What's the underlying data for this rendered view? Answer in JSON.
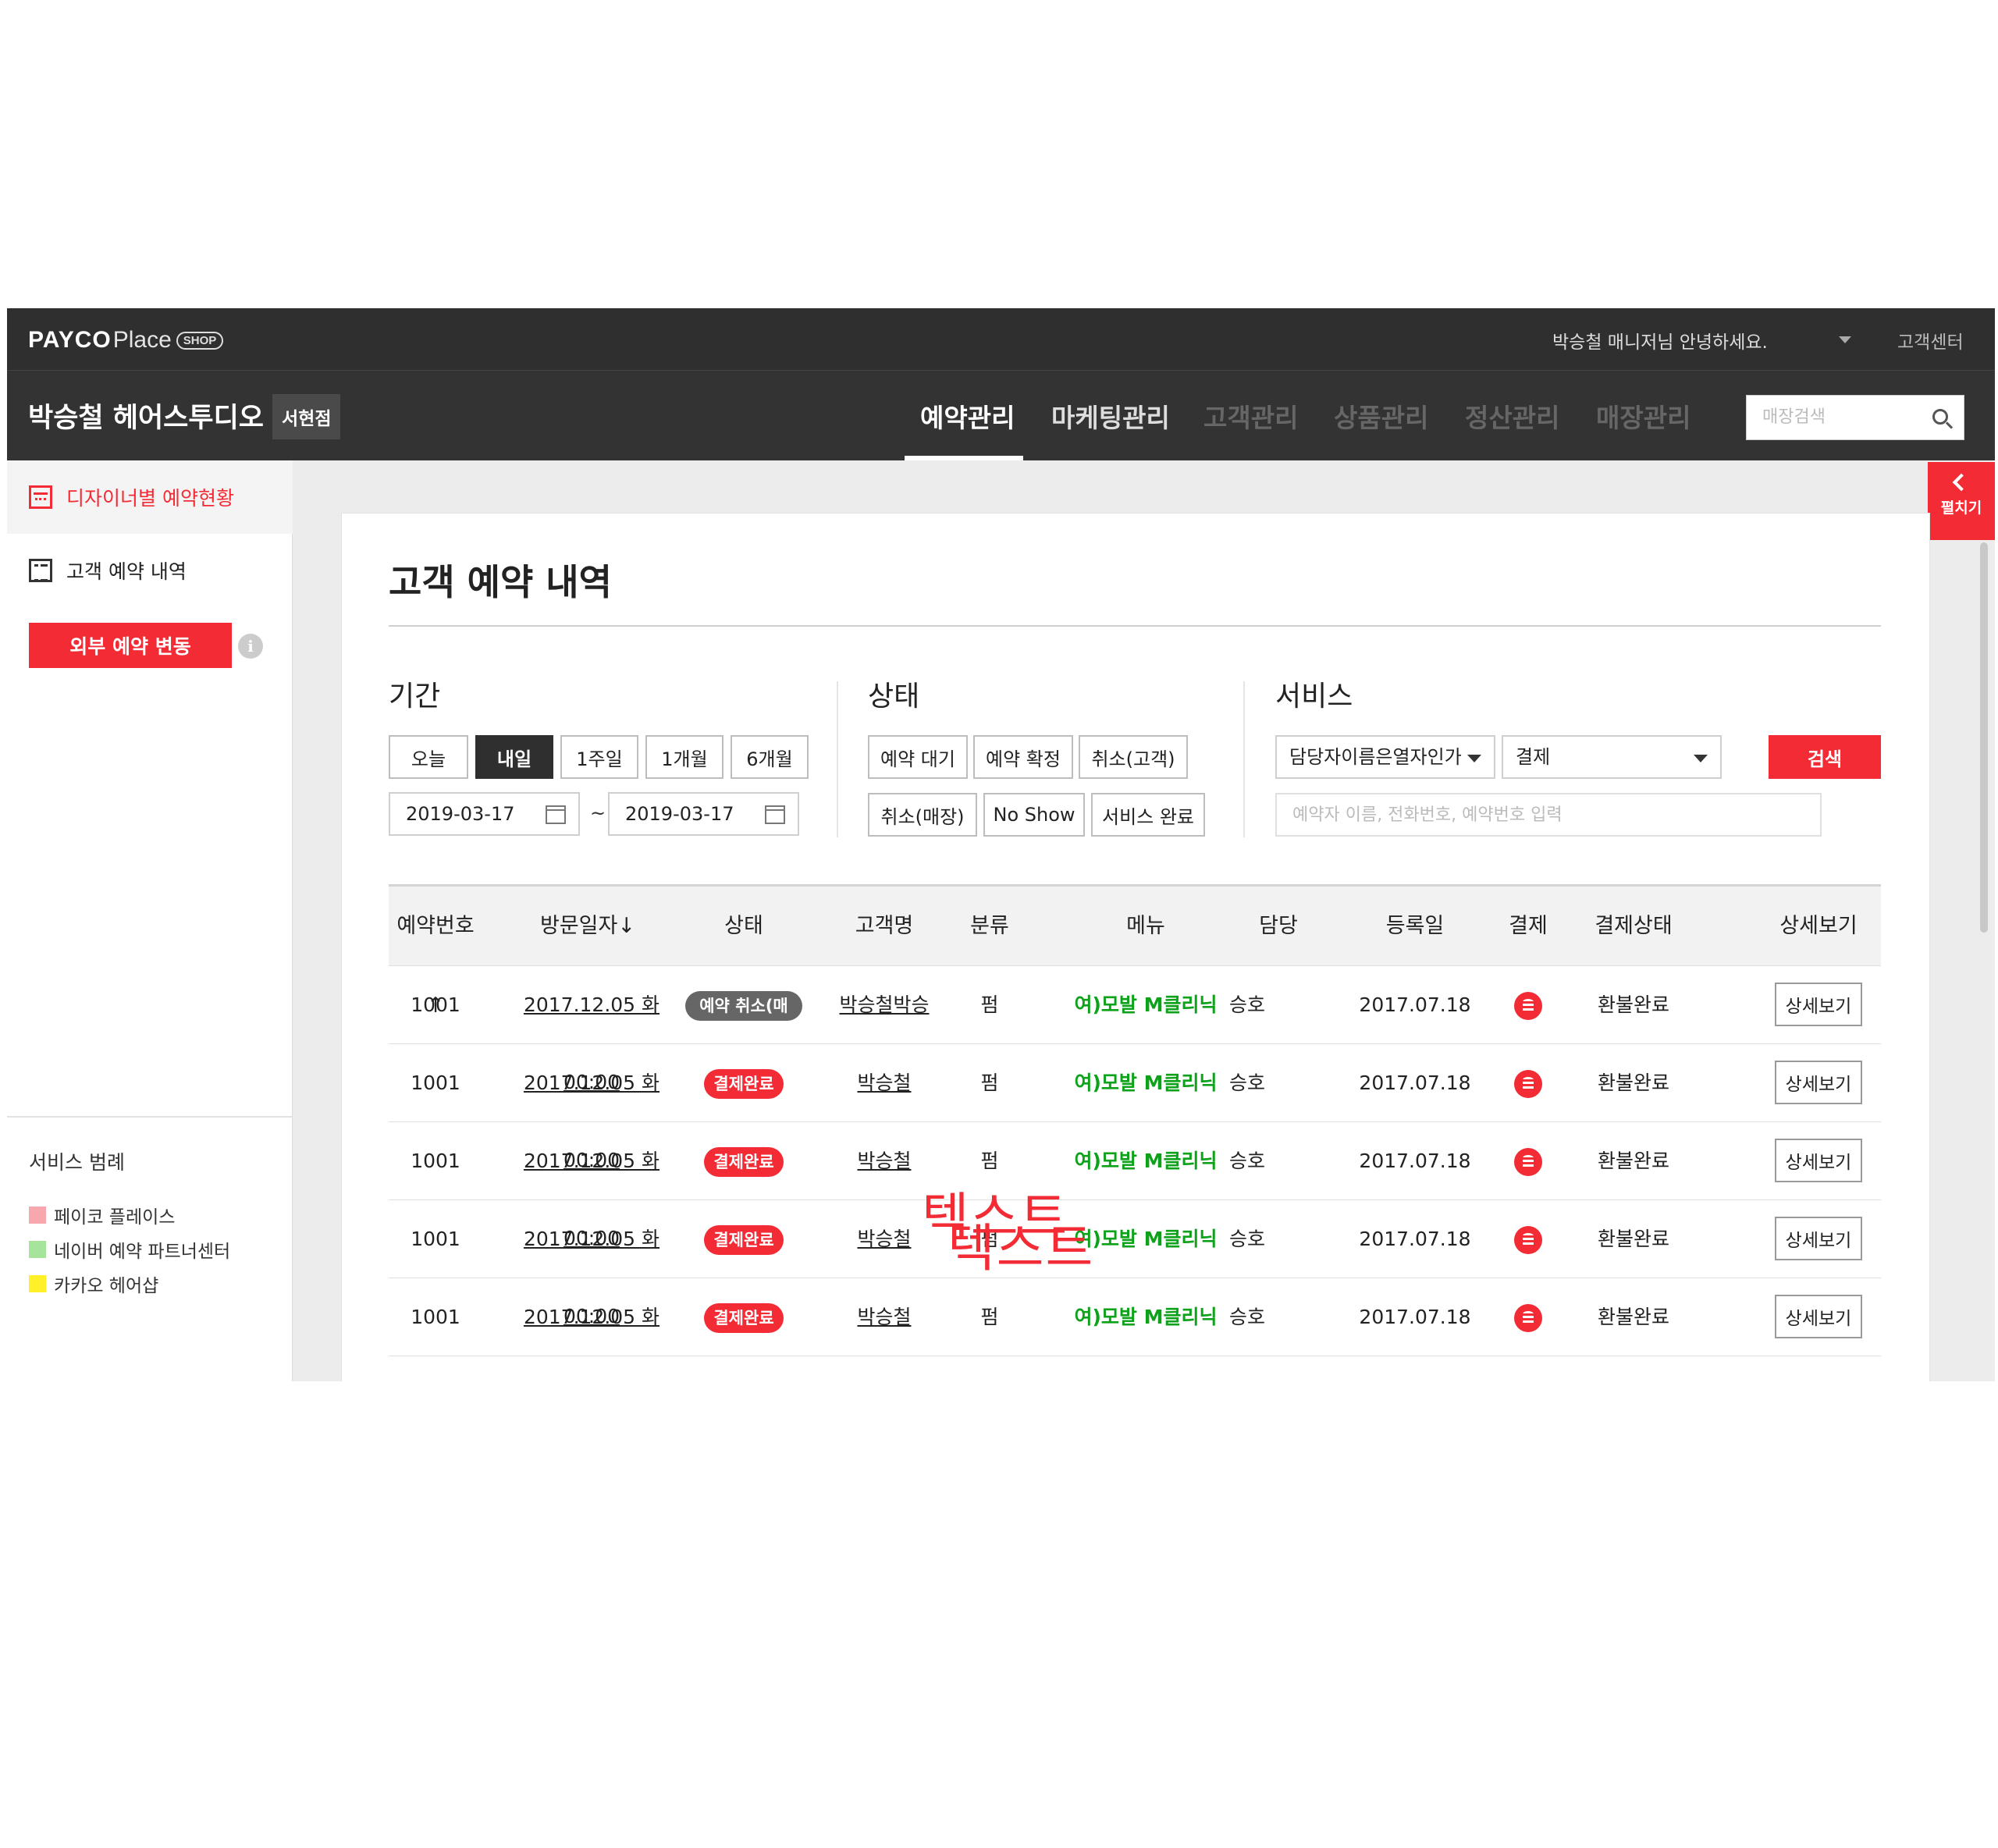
{
  "topbar": {
    "logo_payco": "PAYCO",
    "logo_place": "Place",
    "logo_shop": "SHOP",
    "greeting": "박승철 매니저님 안녕하세요.",
    "help_link": "고객센터"
  },
  "navbar": {
    "shop_name": "박승철 헤어스투디오",
    "branch": "서현점",
    "tabs": [
      {
        "label": "예약관리",
        "active": true
      },
      {
        "label": "마케팅관리"
      },
      {
        "label": "고객관리"
      },
      {
        "label": "상품관리"
      },
      {
        "label": "정산관리"
      },
      {
        "label": "매장관리"
      }
    ],
    "store_search_placeholder": "매장검색"
  },
  "sidebar": {
    "items": [
      {
        "label": "디자이너별 예약현황",
        "icon": "calendar-icon",
        "active": true
      },
      {
        "label": "고객 예약 내역",
        "icon": "list-icon"
      }
    ],
    "external_button": "외부 예약 변동",
    "info_icon": "i",
    "legend_title": "서비스 범례",
    "legend": [
      {
        "label": "페이코 플레이스",
        "color": "#f7a8ae"
      },
      {
        "label": "네이버 예약 파트너센터",
        "color": "#a6e39b"
      },
      {
        "label": "카카오 헤어샵",
        "color": "#fff02a"
      }
    ]
  },
  "fold_tab": {
    "label": "펼치기"
  },
  "page": {
    "title": "고객 예약 내역",
    "period": {
      "label": "기간",
      "buttons": [
        "오늘",
        "내일",
        "1주일",
        "1개월",
        "6개월"
      ],
      "selected": "내일",
      "from": "2019-03-17",
      "to": "2019-03-17",
      "tilde": "~"
    },
    "status": {
      "label": "상태",
      "buttons_row1": [
        "예약 대기",
        "예약 확정",
        "취소(고객)"
      ],
      "buttons_row2": [
        "취소(매장)",
        "No Show",
        "서비스 완료"
      ]
    },
    "service": {
      "label": "서비스",
      "designer_select": "담당자이름은열자인가",
      "payment_select": "결제",
      "search_button": "검색",
      "keyword_placeholder": "예약자 이름, 전화번호, 예약번호 입력"
    },
    "table": {
      "headers": [
        "예약번호↑",
        "방문일자↓",
        "상태",
        "고객명",
        "분류",
        "메뉴",
        "담당",
        "등록일",
        "결제",
        "결제상태",
        "상세보기"
      ],
      "rows": [
        {
          "no": "1001",
          "date": "2017.12.05 화 00:00",
          "status": "예약 취소(매장)",
          "status_color": "gray",
          "customer": "박승철박승",
          "category": "펌",
          "menu": "여)모발 M클리닉",
          "staff": "승호",
          "registered": "2017.07.18",
          "payment_icon": "coin-icon",
          "pay_status": "환불완료",
          "detail": "상세보기"
        },
        {
          "no": "1001",
          "date": "2017.12.05 화 00:00",
          "status": "결제완료",
          "status_color": "red",
          "customer": "박승철",
          "category": "펌",
          "menu": "여)모발 M클리닉",
          "staff": "승호",
          "registered": "2017.07.18",
          "payment_icon": "coin-icon",
          "pay_status": "환불완료",
          "detail": "상세보기"
        },
        {
          "no": "1001",
          "date": "2017.12.05 화 00:00",
          "status": "결제완료",
          "status_color": "red",
          "customer": "박승철",
          "category": "펌",
          "menu": "여)모발 M클리닉",
          "staff": "승호",
          "registered": "2017.07.18",
          "payment_icon": "coin-icon",
          "pay_status": "환불완료",
          "detail": "상세보기"
        },
        {
          "no": "1001",
          "date": "2017.12.05 화 00:00",
          "status": "결제완료",
          "status_color": "red",
          "customer": "박승철",
          "category": "펌",
          "menu": "여)모발 M클리닉",
          "staff": "승호",
          "registered": "2017.07.18",
          "payment_icon": "coin-icon",
          "pay_status": "환불완료",
          "detail": "상세보기"
        },
        {
          "no": "1001",
          "date": "2017.12.05 화 00:00",
          "status": "결제완료",
          "status_color": "red",
          "customer": "박승철",
          "category": "펌",
          "menu": "여)모발 M클리닉",
          "staff": "승호",
          "registered": "2017.07.18",
          "payment_icon": "coin-icon",
          "pay_status": "환불완료",
          "detail": "상세보기"
        }
      ]
    }
  },
  "overlay_text": [
    "텍스트",
    "텍스트"
  ],
  "colors": {
    "accent": "#f22b35",
    "header_bg": "#2f2f2f",
    "menu_green": "#0ea11a"
  }
}
